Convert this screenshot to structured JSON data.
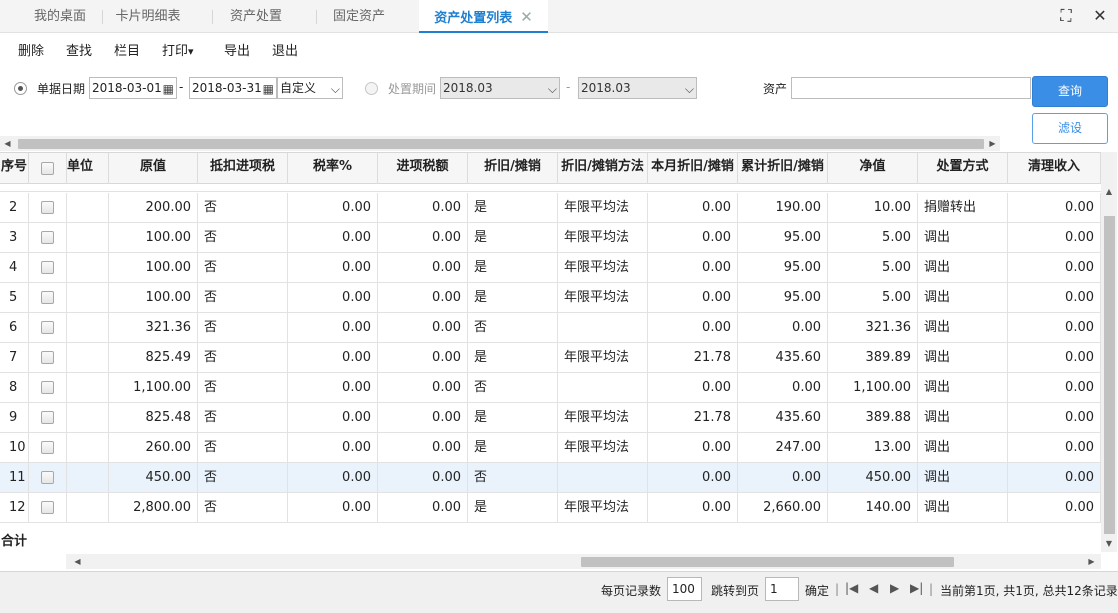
{
  "tabs": [
    {
      "label": "我的桌面"
    },
    {
      "label": "卡片明细表"
    },
    {
      "label": "资产处置"
    },
    {
      "label": "固定资产"
    },
    {
      "label": "资产处置列表",
      "close": "✕"
    }
  ],
  "window_icons": {
    "restore": "⛶",
    "close": "✕"
  },
  "menu": [
    "删除",
    "查找",
    "栏目",
    "打印",
    "导出",
    "退出"
  ],
  "menu_dropdown_icon": "▾",
  "filter": {
    "date_label": "单据日期",
    "date_from": "2018-03-01",
    "date_sep": "-",
    "date_to": "2018-03-31",
    "date_mode": "自定义",
    "period_label": "处置期间",
    "period_from": "2018.03",
    "period_sep": "-",
    "period_to": "2018.03",
    "asset_label": "资产",
    "asset_value": "",
    "query_button": "查询",
    "filter_button": "滤设"
  },
  "columns": [
    "序号",
    "",
    "单位",
    "原值",
    "抵扣进项税",
    "税率%",
    "进项税额",
    "折旧/摊销",
    "折旧/摊销方法",
    "本月折旧/摊销",
    "累计折旧/摊销",
    "净值",
    "处置方式",
    "清理收入"
  ],
  "rows": [
    {
      "no": "2",
      "orig": "200.00",
      "deduct": "否",
      "rate": "0.00",
      "tax": "0.00",
      "dep": "是",
      "method": "年限平均法",
      "month": "0.00",
      "accum": "190.00",
      "net": "10.00",
      "way": "捐赠转出",
      "income": "0.00"
    },
    {
      "no": "3",
      "orig": "100.00",
      "deduct": "否",
      "rate": "0.00",
      "tax": "0.00",
      "dep": "是",
      "method": "年限平均法",
      "month": "0.00",
      "accum": "95.00",
      "net": "5.00",
      "way": "调出",
      "income": "0.00"
    },
    {
      "no": "4",
      "orig": "100.00",
      "deduct": "否",
      "rate": "0.00",
      "tax": "0.00",
      "dep": "是",
      "method": "年限平均法",
      "month": "0.00",
      "accum": "95.00",
      "net": "5.00",
      "way": "调出",
      "income": "0.00"
    },
    {
      "no": "5",
      "orig": "100.00",
      "deduct": "否",
      "rate": "0.00",
      "tax": "0.00",
      "dep": "是",
      "method": "年限平均法",
      "month": "0.00",
      "accum": "95.00",
      "net": "5.00",
      "way": "调出",
      "income": "0.00"
    },
    {
      "no": "6",
      "orig": "321.36",
      "deduct": "否",
      "rate": "0.00",
      "tax": "0.00",
      "dep": "否",
      "method": "",
      "month": "0.00",
      "accum": "0.00",
      "net": "321.36",
      "way": "调出",
      "income": "0.00"
    },
    {
      "no": "7",
      "orig": "825.49",
      "deduct": "否",
      "rate": "0.00",
      "tax": "0.00",
      "dep": "是",
      "method": "年限平均法",
      "month": "21.78",
      "accum": "435.60",
      "net": "389.89",
      "way": "调出",
      "income": "0.00"
    },
    {
      "no": "8",
      "orig": "1,100.00",
      "deduct": "否",
      "rate": "0.00",
      "tax": "0.00",
      "dep": "否",
      "method": "",
      "month": "0.00",
      "accum": "0.00",
      "net": "1,100.00",
      "way": "调出",
      "income": "0.00"
    },
    {
      "no": "9",
      "orig": "825.48",
      "deduct": "否",
      "rate": "0.00",
      "tax": "0.00",
      "dep": "是",
      "method": "年限平均法",
      "month": "21.78",
      "accum": "435.60",
      "net": "389.88",
      "way": "调出",
      "income": "0.00"
    },
    {
      "no": "10",
      "orig": "260.00",
      "deduct": "否",
      "rate": "0.00",
      "tax": "0.00",
      "dep": "是",
      "method": "年限平均法",
      "month": "0.00",
      "accum": "247.00",
      "net": "13.00",
      "way": "调出",
      "income": "0.00"
    },
    {
      "no": "11",
      "orig": "450.00",
      "deduct": "否",
      "rate": "0.00",
      "tax": "0.00",
      "dep": "否",
      "method": "",
      "month": "0.00",
      "accum": "0.00",
      "net": "450.00",
      "way": "调出",
      "income": "0.00",
      "selected": true
    },
    {
      "no": "12",
      "orig": "2,800.00",
      "deduct": "否",
      "rate": "0.00",
      "tax": "0.00",
      "dep": "是",
      "method": "年限平均法",
      "month": "0.00",
      "accum": "2,660.00",
      "net": "140.00",
      "way": "调出",
      "income": "0.00"
    }
  ],
  "totals_label": "合计",
  "pager": {
    "per_page_label": "每页记录数",
    "per_page": "100",
    "goto_label": "跳转到页",
    "goto_page": "1",
    "confirm": "确定",
    "sep": "|",
    "first_icon": "|◀",
    "prev_icon": "◀",
    "next_icon": "▶",
    "last_icon": "▶|",
    "summary": "当前第1页, 共1页, 总共12条记录"
  }
}
